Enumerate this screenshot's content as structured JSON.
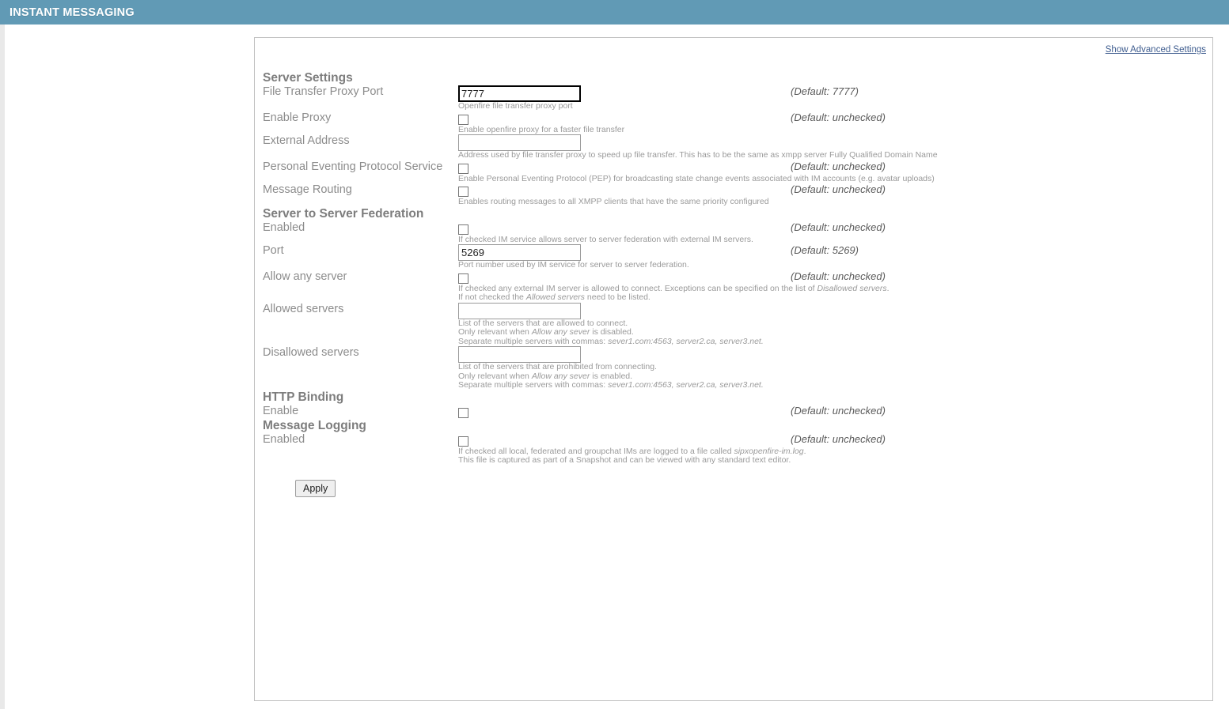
{
  "header": {
    "title": "INSTANT MESSAGING",
    "bg_color": "#619ab5",
    "text_color": "#ffffff"
  },
  "panel": {
    "advanced_settings_link": "Show Advanced Settings",
    "link_color": "#3f5d8f"
  },
  "sections": {
    "server_settings": {
      "heading": "Server Settings",
      "fields": {
        "file_transfer_proxy_port": {
          "label": "File Transfer Proxy Port",
          "value": "7777",
          "help": "Openfire file transfer proxy port",
          "default": "(Default: 7777)"
        },
        "enable_proxy": {
          "label": "Enable Proxy",
          "checked": false,
          "help": "Enable openfire proxy for a faster file transfer",
          "default": "(Default: unchecked)"
        },
        "external_address": {
          "label": "External Address",
          "value": "",
          "help": "Address used by file transfer proxy to speed up file transfer. This has to be the same as xmpp server Fully Qualified Domain Name",
          "default": ""
        },
        "pep_service": {
          "label": "Personal Eventing Protocol Service",
          "checked": false,
          "help": "Enable Personal Eventing Protocol (PEP) for broadcasting state change events associated with IM accounts (e.g. avatar uploads)",
          "default": "(Default: unchecked)"
        },
        "message_routing": {
          "label": "Message Routing",
          "checked": false,
          "help": "Enables routing messages to all XMPP clients that have the same priority configured",
          "default": "(Default: unchecked)"
        }
      }
    },
    "server_to_server_federation": {
      "heading": "Server to Server Federation",
      "fields": {
        "enabled": {
          "label": "Enabled",
          "checked": false,
          "help": "If checked IM service allows server to server federation with external IM servers.",
          "default": "(Default: unchecked)"
        },
        "port": {
          "label": "Port",
          "value": "5269",
          "help": "Port number used by IM service for server to server federation.",
          "default": "(Default: 5269)"
        },
        "allow_any_server": {
          "label": "Allow any server",
          "checked": false,
          "help_line1_a": "If checked any external IM server is allowed to connect. Exceptions can be specified on the list of ",
          "help_line1_em": "Disallowed servers",
          "help_line1_b": ".",
          "help_line2_a": "If not checked the ",
          "help_line2_em": "Allowed servers",
          "help_line2_b": " need to be listed.",
          "default": "(Default: unchecked)"
        },
        "allowed_servers": {
          "label": "Allowed servers",
          "value": "",
          "help_line1": "List of the servers that are allowed to connect.",
          "help_line2_a": "Only relevant when ",
          "help_line2_em": "Allow any sever",
          "help_line2_b": " is disabled.",
          "help_line3_a": "Separate multiple servers with commas: ",
          "help_line3_em": "sever1.com:4563, server2.ca, server3.net.",
          "default": ""
        },
        "disallowed_servers": {
          "label": "Disallowed servers",
          "value": "",
          "help_line1": "List of the servers that are prohibited from connecting.",
          "help_line2_a": "Only relevant when ",
          "help_line2_em": "Allow any sever",
          "help_line2_b": " is enabled.",
          "help_line3_a": "Separate multiple servers with commas: ",
          "help_line3_em": "sever1.com:4563, server2.ca, server3.net.",
          "default": ""
        }
      }
    },
    "http_binding": {
      "heading": "HTTP Binding",
      "fields": {
        "enable": {
          "label": "Enable",
          "checked": false,
          "default": "(Default: unchecked)"
        }
      }
    },
    "message_logging": {
      "heading": "Message Logging",
      "fields": {
        "enabled": {
          "label": "Enabled",
          "checked": false,
          "help_line1_a": "If checked all local, federated and groupchat IMs are logged to a file called ",
          "help_line1_em": "sipxopenfire-im.log",
          "help_line1_b": ".",
          "help_line2": "This file is captured as part of a Snapshot and can be viewed with any standard text editor.",
          "default": "(Default: unchecked)"
        }
      }
    }
  },
  "footer": {
    "apply_label": "Apply"
  }
}
